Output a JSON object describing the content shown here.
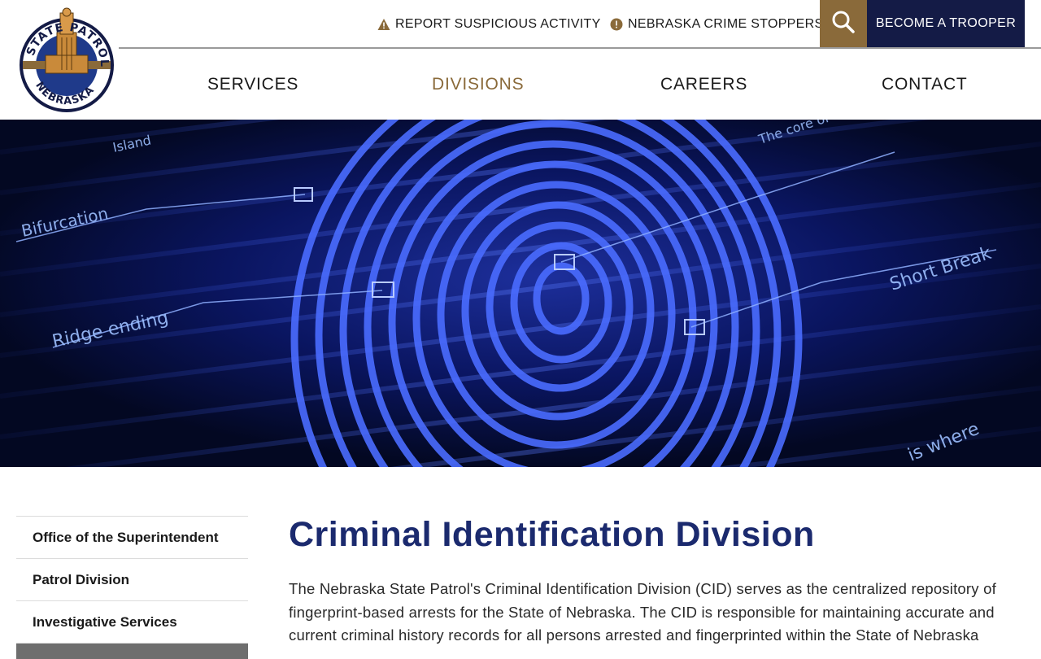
{
  "logo": {
    "text_top": "STATE PATROL",
    "text_bottom": "NEBRASKA"
  },
  "utility": {
    "report_label": "REPORT SUSPICIOUS ACTIVITY",
    "report_icon": "warning-triangle-icon",
    "stoppers_label": "NEBRASKA CRIME STOPPERS",
    "stoppers_icon": "exclamation-circle-icon",
    "search_icon": "search-icon",
    "trooper_label": "BECOME A TROOPER"
  },
  "nav": {
    "items": [
      {
        "label": "SERVICES",
        "active": false
      },
      {
        "label": "DIVISIONS",
        "active": true
      },
      {
        "label": "CAREERS",
        "active": false
      },
      {
        "label": "CONTACT",
        "active": false
      }
    ]
  },
  "hero": {
    "labels": [
      "Island",
      "Bifurcation",
      "Ridge ending",
      "Short Break",
      "The core of fingerprint",
      "is where"
    ]
  },
  "sidebar": {
    "items": [
      {
        "label": "Office of the Superintendent"
      },
      {
        "label": "Patrol Division"
      },
      {
        "label": "Investigative Services"
      }
    ]
  },
  "main": {
    "title": "Criminal Identification Division",
    "intro": "The Nebraska State Patrol's Criminal Identification Division (CID) serves as the centralized repository of fingerprint-based arrests for the State of Nebraska. The CID is responsible for maintaining accurate and current criminal history records for all persons arrested and fingerprinted within the State of Nebraska"
  },
  "colors": {
    "brand_navy": "#141b46",
    "brand_gold": "#8a6a3a",
    "title_blue": "#1b2a6e"
  }
}
